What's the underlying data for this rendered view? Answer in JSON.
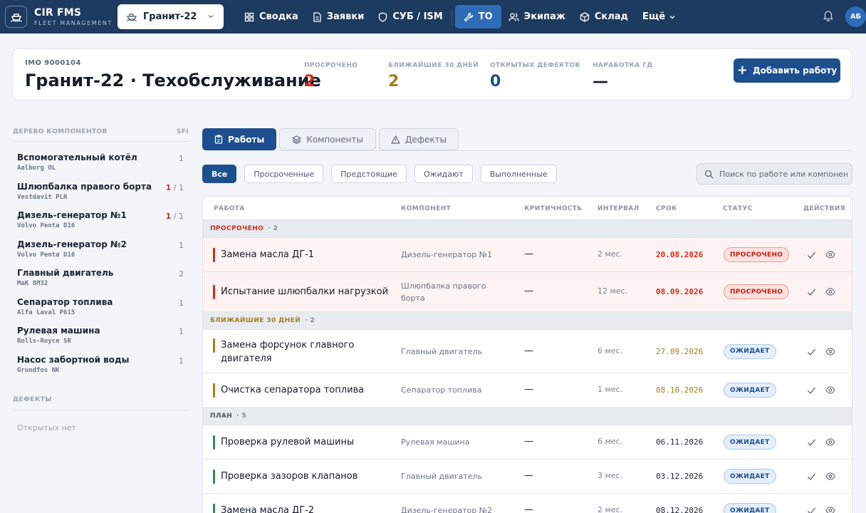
{
  "app": {
    "name": "CIR FMS",
    "subtitle": "FLEET MANAGEMENT"
  },
  "vessel_select": {
    "value": "Гранит-22"
  },
  "nav": {
    "items": [
      {
        "label": "Сводка",
        "icon": "grid-icon"
      },
      {
        "label": "Заявки",
        "icon": "document-icon"
      },
      {
        "label": "СУБ / ISM",
        "icon": "shield-icon"
      },
      {
        "label": "ТО",
        "icon": "wrench-icon",
        "active": true
      },
      {
        "label": "Экипаж",
        "icon": "users-icon"
      },
      {
        "label": "Склад",
        "icon": "box-icon"
      }
    ],
    "more_label": "Ещё",
    "avatar": "АБ"
  },
  "header": {
    "imo": "IMO 9000104",
    "title": "Гранит-22 · Техобслуживание",
    "kpis": [
      {
        "label": "ПРОСРОЧЕНО",
        "value": "2",
        "color": "#d42b1e"
      },
      {
        "label": "БЛИЖАЙШИЕ 30 ДНЕЙ",
        "value": "2",
        "color": "#a67c1c"
      },
      {
        "label": "ОТКРЫТЫХ ДЕФЕКТОВ",
        "value": "0",
        "color": "#1d4e8e"
      },
      {
        "label": "НАРАБОТКА ГД",
        "value": "—",
        "color": "#141c28"
      }
    ],
    "add_button": "Добавить работу"
  },
  "sidebar": {
    "tree_title": "ДЕРЕВО КОМПОНЕНТОВ",
    "tree_code": "SFI",
    "components": [
      {
        "name": "Вспомогательный котёл",
        "model": "Aalborg OL",
        "overdue": "",
        "count": "1"
      },
      {
        "name": "Шлюпбалка правого борта",
        "model": "Vestdavit PLR",
        "overdue": "1",
        "count": "1"
      },
      {
        "name": "Дизель-генератор №1",
        "model": "Volvo Penta D16",
        "overdue": "1",
        "count": "1"
      },
      {
        "name": "Дизель-генератор №2",
        "model": "Volvo Penta D16",
        "overdue": "",
        "count": "1"
      },
      {
        "name": "Главный двигатель",
        "model": "MaK 8M32",
        "overdue": "",
        "count": "2"
      },
      {
        "name": "Сепаратор топлива",
        "model": "Alfa Laval P615",
        "overdue": "",
        "count": "1"
      },
      {
        "name": "Рулевая машина",
        "model": "Rolls-Royce SR",
        "overdue": "",
        "count": "1"
      },
      {
        "name": "Насос забортной воды",
        "model": "Grundfos NK",
        "overdue": "",
        "count": "1"
      }
    ],
    "defects_title": "ДЕФЕКТЫ",
    "defects_empty": "Открытых нет"
  },
  "tabs": [
    {
      "label": "Работы",
      "icon": "clipboard-icon",
      "active": true
    },
    {
      "label": "Компоненты",
      "icon": "layers-icon"
    },
    {
      "label": "Дефекты",
      "icon": "warning-icon"
    }
  ],
  "filters": [
    {
      "label": "Все",
      "active": true
    },
    {
      "label": "Просроченные"
    },
    {
      "label": "Предстоящие"
    },
    {
      "label": "Ожидают"
    },
    {
      "label": "Выполненные"
    }
  ],
  "search": {
    "placeholder": "Поиск по работе или компоненту"
  },
  "table": {
    "headers": [
      "РАБОТА",
      "КОМПОНЕНТ",
      "КРИТИЧНОСТЬ",
      "ИНТЕРВАЛ",
      "СРОК",
      "СТАТУС",
      "ДЕЙСТВИЯ"
    ],
    "groups": [
      {
        "title": "ПРОСРОЧЕНО",
        "count": "2",
        "color": "#d42b1e",
        "kind": "overdue",
        "rows": [
          {
            "work": "Замена масла ДГ-1",
            "component": "Дизель-генератор №1",
            "crit": "—",
            "interval": "2 мес.",
            "due": "20.08.2026",
            "status": "ПРОСРОЧЕНО"
          },
          {
            "work": "Испытание шлюпбалки нагрузкой",
            "component": "Шлюпбалка правого борта",
            "crit": "—",
            "interval": "12 мес.",
            "due": "08.09.2026",
            "status": "ПРОСРОЧЕНО"
          }
        ]
      },
      {
        "title": "БЛИЖАЙШИЕ 30 ДНЕЙ",
        "count": "2",
        "color": "#a67c1c",
        "kind": "soon",
        "rows": [
          {
            "work": "Замена форсунок главного двигателя",
            "component": "Главный двигатель",
            "crit": "—",
            "interval": "6 мес.",
            "due": "27.09.2026",
            "status": "ОЖИДАЕТ"
          },
          {
            "work": "Очистка сепаратора топлива",
            "component": "Сепаратор топлива",
            "crit": "—",
            "interval": "1 мес.",
            "due": "08.10.2026",
            "status": "ОЖИДАЕТ"
          }
        ]
      },
      {
        "title": "ПЛАН",
        "count": "5",
        "color": "#4c5766",
        "kind": "plan",
        "rows": [
          {
            "work": "Проверка рулевой машины",
            "component": "Рулевая машина",
            "crit": "—",
            "interval": "6 мес.",
            "due": "06.11.2026",
            "status": "ОЖИДАЕТ"
          },
          {
            "work": "Проверка зазоров клапанов",
            "component": "Главный двигатель",
            "crit": "—",
            "interval": "3 мес.",
            "due": "03.12.2026",
            "status": "ОЖИДАЕТ"
          },
          {
            "work": "Замена масла ДГ-2",
            "component": "Дизель-генератор №2",
            "crit": "—",
            "interval": "2 мес.",
            "due": "08.12.2026",
            "status": "ОЖИДАЕТ"
          }
        ]
      }
    ]
  },
  "colors": {
    "topbar": "#1d3a5f",
    "accent": "#1d4e8e",
    "overdue": "#d42b1e",
    "soon": "#a67c1c",
    "plan": "#2f8a5a"
  }
}
